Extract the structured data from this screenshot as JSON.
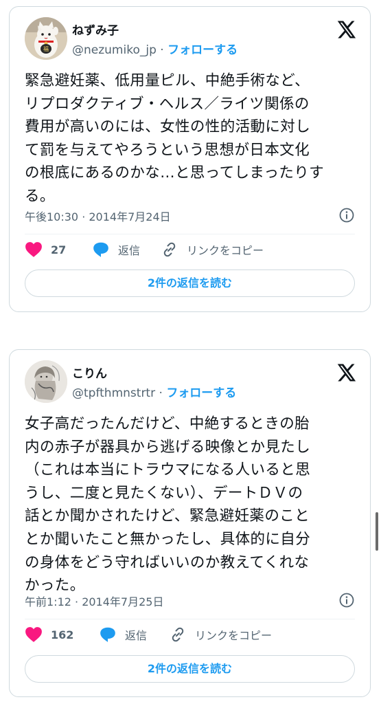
{
  "colors": {
    "accent": "#1d9bf0",
    "like": "#f91880",
    "muted": "#536471",
    "text": "#0f1419"
  },
  "tweets": [
    {
      "name": "ねずみ子",
      "handle": "@nezumiko_jp",
      "separator": " · ",
      "follow": "フォローする",
      "text": "緊急避妊薬、低用量ピル、中絶手術など、\nリプロダクティブ・ヘルス／ライツ関係の\n費用が高いのには、女性の性的活動に対し\nて罰を与えてやろうという思想が日本文化\nの根底にあるのかな…と思ってしまったりす\nる。",
      "timestamp": "午後10:30 · 2014年7月24日",
      "likes": "27",
      "reply_label": "返信",
      "copy_link_label": "リンクをコピー",
      "read_replies": "2件の返信を読む"
    },
    {
      "name": "こりん",
      "handle": "@tpfthmnstrtr",
      "separator": " · ",
      "follow": "フォローする",
      "text": "女子高だったんだけど、中絶するときの胎\n内の赤子が器具から逃げる映像とか見たし\n（これは本当にトラウマになる人いると思\nうし、二度と見たくない）、デートＤＶの\n話とか聞かされたけど、緊急避妊薬のこと\nとか聞いたこと無かったし、具体的に自分\nの身体をどう守ればいいのか教えてくれな\nかった。",
      "timestamp": "午前1:12 · 2014年7月25日",
      "likes": "162",
      "reply_label": "返信",
      "copy_link_label": "リンクをコピー",
      "read_replies": "2件の返信を読む"
    }
  ]
}
